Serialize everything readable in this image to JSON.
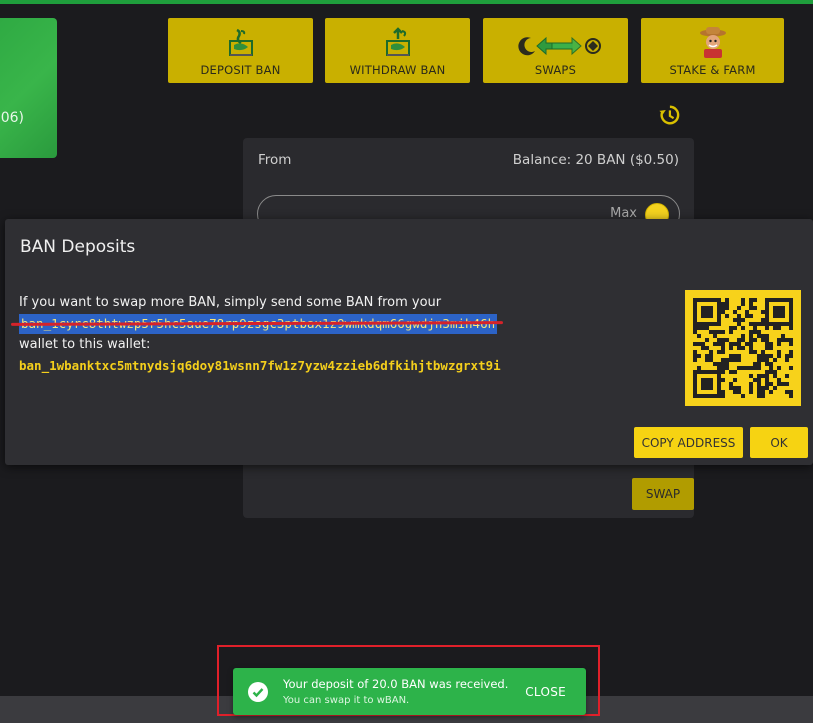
{
  "background_card": {
    "value_fragment": "06)"
  },
  "nav": {
    "deposit": {
      "label": "DEPOSIT BAN",
      "icon": "deposit-icon"
    },
    "withdraw": {
      "label": "WITHDRAW BAN",
      "icon": "withdraw-icon"
    },
    "swaps": {
      "label": "SWAPS",
      "icon": "swaps-icon"
    },
    "stake": {
      "label": "STAKE & FARM",
      "icon": "farmer-icon"
    }
  },
  "swap_panel": {
    "from_label": "From",
    "balance": "Balance: 20 BAN ($0.50)",
    "max_label": "Max",
    "swap_button": "SWAP"
  },
  "modal": {
    "title": "BAN Deposits",
    "line1": "If you want to swap more BAN, simply send some BAN from your",
    "source_address": "ban_1cyrc8thtwzp5r5hc5aue78rp9zsgc3ptbax1z9wmkdqm66gwdjn3mih46h",
    "line3": "wallet to this wallet:",
    "wallet_address": "ban_1wbanktxc5mtnydsjq6doy81wsnn7fw1z7yzw4zzieb6dfkihjtbwzgrxt9i",
    "copy_button": "COPY ADDRESS",
    "ok_button": "OK"
  },
  "toast": {
    "message": "Your deposit of 20.0 BAN was received.",
    "submessage": "You can swap it to wBAN.",
    "close_label": "CLOSE"
  },
  "colors": {
    "accent": "#f6d312",
    "nav_button": "#c9b000",
    "toast": "#2db34a",
    "highlight": "#e0202a",
    "selection": "#2c63c7"
  }
}
